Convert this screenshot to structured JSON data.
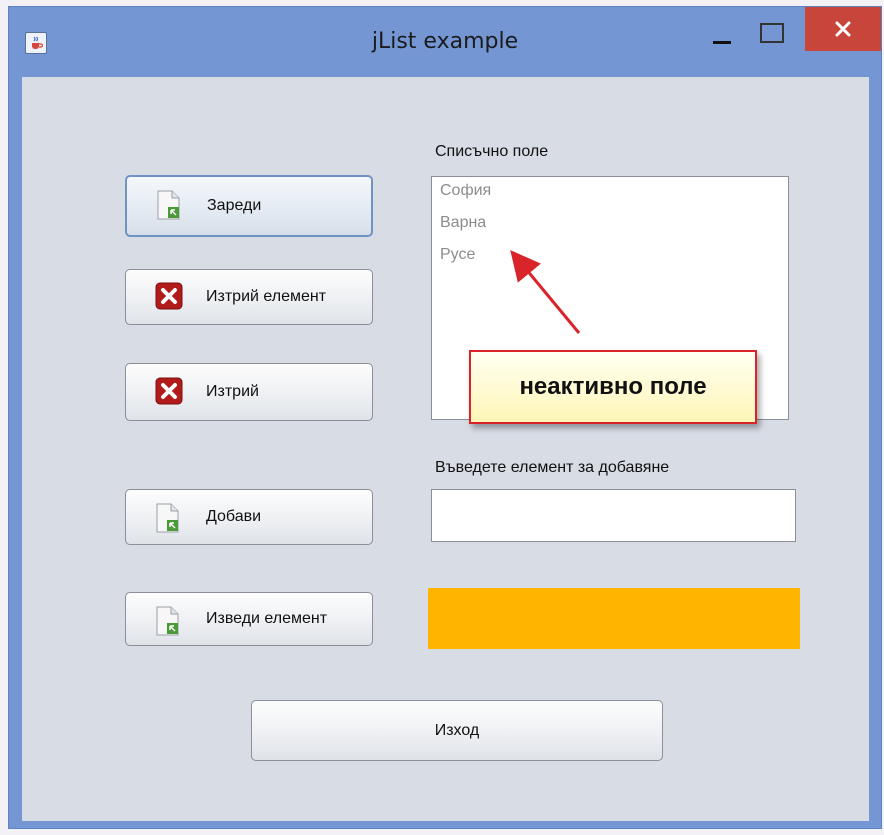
{
  "window": {
    "title": "jList example"
  },
  "buttons": {
    "load": "Зареди",
    "delete_item": "Изтрий елемент",
    "delete": "Изтрий",
    "add": "Добави",
    "output_item": "Изведи елемент",
    "exit": "Изход"
  },
  "list_panel": {
    "label": "Списъчно поле",
    "items": [
      "София",
      "Варна",
      "Русе"
    ]
  },
  "input_panel": {
    "label": "Въведете елемент за добавяне",
    "value": ""
  },
  "annotation": {
    "callout_text": "неактивно поле",
    "border_color": "#d9252a"
  },
  "colors": {
    "titlebar": "#7497d4",
    "client_bg": "#d8dce5",
    "output_panel": "#ffb400",
    "close_button": "#c7453b"
  },
  "icons": {
    "app": "java-cup-icon",
    "document": "document-arrow-icon",
    "delete": "red-x-icon"
  }
}
